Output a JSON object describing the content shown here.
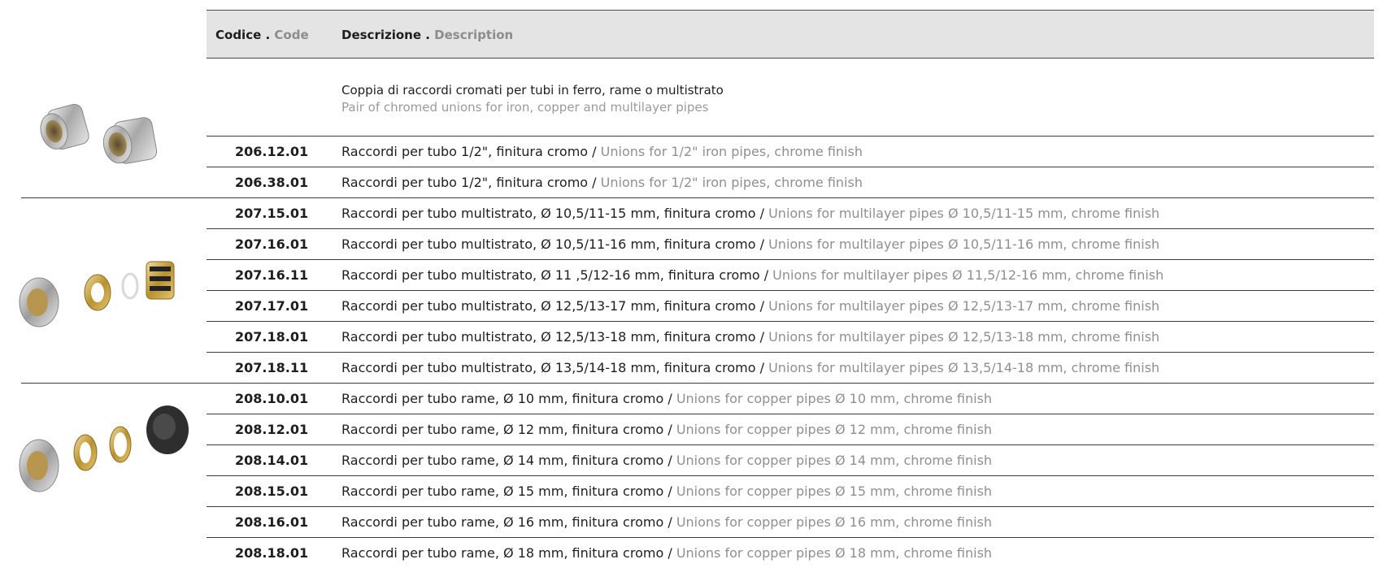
{
  "header": {
    "code_it": "Codice .",
    "code_en": "Code",
    "desc_it": "Descrizione .",
    "desc_en": "Description"
  },
  "intro": {
    "it": "Coppia di raccordi cromati per tubi in ferro, rame o multistrato",
    "en": "Pair of chromed unions for iron, copper and multilayer pipes"
  },
  "rows": [
    {
      "code": "206.12.01",
      "it": "Raccordi per tubo 1/2\", finitura cromo /",
      "en": "Unions for 1/2\" iron pipes, chrome finish"
    },
    {
      "code": "206.38.01",
      "it": "Raccordi per tubo 1/2\", finitura cromo /",
      "en": "Unions for 1/2\" iron pipes, chrome finish"
    },
    {
      "code": "207.15.01",
      "it": "Raccordi per tubo multistrato, Ø 10,5/11-15 mm, finitura cromo /",
      "en": "Unions for multilayer pipes Ø 10,5/11-15 mm, chrome finish"
    },
    {
      "code": "207.16.01",
      "it": "Raccordi per tubo multistrato, Ø 10,5/11-16 mm, finitura cromo /",
      "en": "Unions for multilayer pipes Ø 10,5/11-16 mm, chrome finish"
    },
    {
      "code": "207.16.11",
      "it": "Raccordi per tubo multistrato, Ø 11 ,5/12-16 mm, finitura cromo /",
      "en": "Unions for multilayer pipes Ø 11,5/12-16 mm, chrome finish"
    },
    {
      "code": "207.17.01",
      "it": "Raccordi per tubo multistrato, Ø 12,5/13-17 mm, finitura cromo /",
      "en": "Unions for multilayer pipes Ø 12,5/13-17 mm, chrome finish"
    },
    {
      "code": "207.18.01",
      "it": "Raccordi per tubo multistrato, Ø 12,5/13-18 mm, finitura cromo /",
      "en": "Unions for multilayer pipes Ø 12,5/13-18 mm, chrome finish"
    },
    {
      "code": "207.18.11",
      "it": "Raccordi per tubo multistrato, Ø 13,5/14-18 mm, finitura cromo /",
      "en": "Unions for multilayer pipes Ø 13,5/14-18 mm, chrome finish"
    },
    {
      "code": "208.10.01",
      "it": "Raccordi per tubo rame, Ø 10 mm, finitura cromo /",
      "en": "Unions for copper pipes Ø 10 mm, chrome finish"
    },
    {
      "code": "208.12.01",
      "it": "Raccordi per tubo rame, Ø 12 mm, finitura cromo /",
      "en": "Unions for copper pipes Ø 12 mm, chrome finish"
    },
    {
      "code": "208.14.01",
      "it": "Raccordi per tubo rame, Ø 14 mm, finitura cromo /",
      "en": "Unions for copper pipes Ø 14 mm, chrome finish"
    },
    {
      "code": "208.15.01",
      "it": "Raccordi per tubo rame, Ø 15 mm, finitura cromo /",
      "en": "Unions for copper pipes Ø 15 mm, chrome finish"
    },
    {
      "code": "208.16.01",
      "it": "Raccordi per tubo rame, Ø 16 mm, finitura cromo /",
      "en": "Unions for copper pipes Ø 16 mm, chrome finish"
    },
    {
      "code": "208.18.01",
      "it": "Raccordi per tubo rame, Ø 18 mm, finitura cromo /",
      "en": "Unions for copper pipes Ø 18 mm, chrome finish"
    }
  ],
  "colors": {
    "header_bg": "#e4e4e4",
    "english_text": "#8f8f8f",
    "rule": "#3c3c3c"
  }
}
